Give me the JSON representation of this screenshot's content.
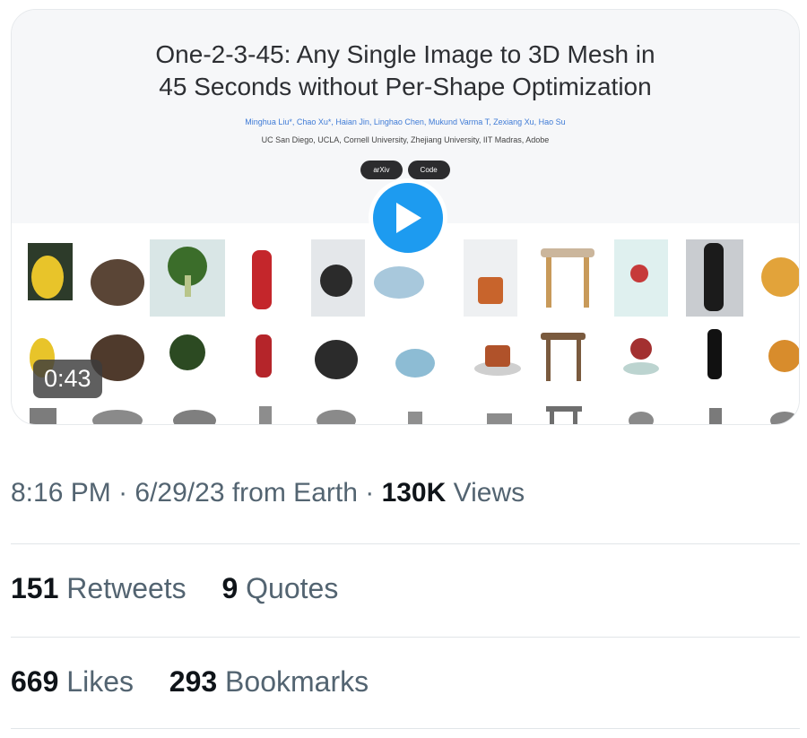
{
  "video": {
    "paper_title_line1": "One-2-3-45: Any Single Image to 3D Mesh in",
    "paper_title_line2": "45 Seconds without Per-Shape Optimization",
    "authors": "Minghua Liu*, Chao Xu*, Haian Jin, Linghao Chen, Mukund Varma T, Zexiang Xu, Hao Su",
    "affiliations": "UC San Diego, UCLA, Cornell University, Zhejiang University, IIT Madras, Adobe",
    "pill_arxiv": "arXiv",
    "pill_code": "Code",
    "duration": "0:43"
  },
  "tweet_meta": {
    "time": "8:16 PM",
    "date": "6/29/23",
    "source": "from Earth",
    "views_count": "130K",
    "views_label": "Views"
  },
  "engagement": {
    "retweets_count": "151",
    "retweets_label": "Retweets",
    "quotes_count": "9",
    "quotes_label": "Quotes",
    "likes_count": "669",
    "likes_label": "Likes",
    "bookmarks_count": "293",
    "bookmarks_label": "Bookmarks"
  },
  "colors": {
    "accent": "#1d9bf0",
    "secondary_text": "#536471",
    "primary_text": "#0f1419"
  }
}
